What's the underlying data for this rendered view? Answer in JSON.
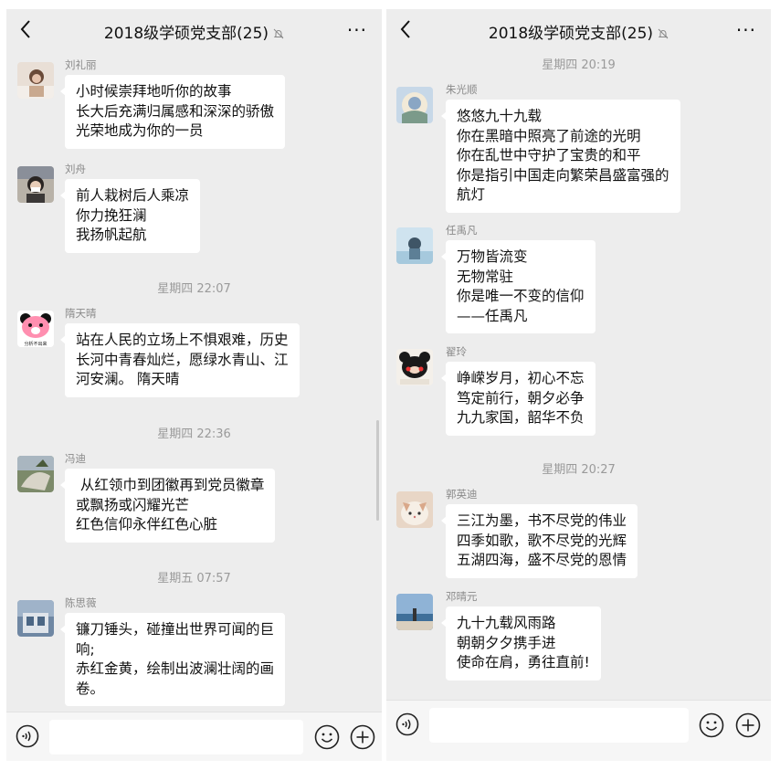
{
  "chat_title": "2018级学硕党支部(25)",
  "more_label": "···",
  "left": {
    "times": [
      "星期四 22:07",
      "星期四 22:36",
      "星期五 07:57"
    ],
    "messages": [
      {
        "sender": "刘礼丽",
        "lines": [
          "小时候崇拜地听你的故事",
          "长大后充满归属感和深深的骄傲",
          "光荣地成为你的一员"
        ]
      },
      {
        "sender": "刘舟",
        "lines": [
          "前人栽树后人乘凉",
          "你力挽狂澜",
          "我扬帆起航"
        ]
      },
      {
        "sender": "隋天晴",
        "lines": [
          "站在人民的立场上不惧艰难，历史",
          "长河中青春灿烂，愿绿水青山、江",
          "河安澜。 隋天晴"
        ]
      },
      {
        "sender": "冯迪",
        "lines": [
          " 从红领巾到团徽再到党员徽章",
          "或飘扬或闪耀光芒",
          "红色信仰永伴红色心脏"
        ]
      },
      {
        "sender": "陈思薇",
        "lines": [
          "镰刀锤头，碰撞出世界可闻的巨",
          "响;",
          "赤红金黄，绘制出波澜壮阔的画",
          "卷。"
        ]
      }
    ],
    "avatar_caption": "分析不出来"
  },
  "right": {
    "times": [
      "星期四 20:19",
      "星期四 20:27"
    ],
    "messages": [
      {
        "sender": "朱光顺",
        "lines": [
          "悠悠九十九载",
          "你在黑暗中照亮了前途的光明",
          "你在乱世中守护了宝贵的和平",
          "你是指引中国走向繁荣昌盛富强的",
          "航灯"
        ]
      },
      {
        "sender": "任禹凡",
        "lines": [
          "万物皆流变",
          "无物常驻",
          "你是唯一不变的信仰",
          "——任禹凡"
        ]
      },
      {
        "sender": "翟玲",
        "lines": [
          "峥嵘岁月，初心不忘",
          "笃定前行，朝夕必争",
          "九九家国，韶华不负"
        ]
      },
      {
        "sender": "郭英迪",
        "lines": [
          "三江为墨，书不尽党的伟业",
          "四季如歌，歌不尽党的光辉",
          "五湖四海，盛不尽党的恩情"
        ]
      },
      {
        "sender": "邓晴元",
        "lines": [
          "九十九载风雨路",
          "朝朝夕夕携手进",
          "使命在肩，勇往直前!"
        ]
      }
    ]
  },
  "icons": {
    "back": "chevron-left-icon",
    "mute": "bell-off-icon",
    "voice": "voice-icon",
    "emoji": "emoji-smile-icon",
    "plus": "plus-circle-icon"
  }
}
